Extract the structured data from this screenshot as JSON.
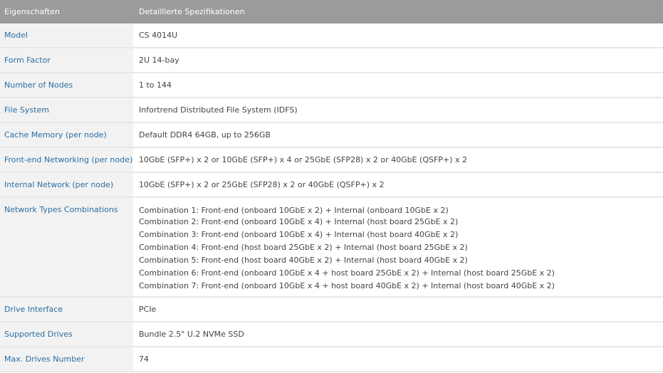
{
  "header": {
    "property": "Eigenschaften",
    "value": "Detaillierte Spezifikationen"
  },
  "rows": [
    {
      "property": "Model",
      "value": "CS 4014U"
    },
    {
      "property": "Form Factor",
      "value": "2U 14-bay"
    },
    {
      "property": "Number of Nodes",
      "value": "1 to 144"
    },
    {
      "property": "File System",
      "value": "Infortrend Distributed File System (IDFS)"
    },
    {
      "property": "Cache Memory (per node)",
      "value": "Default DDR4 64GB, up to 256GB"
    },
    {
      "property": "Front-end Networking (per node)",
      "value": "10GbE (SFP+) x 2 or 10GbE (SFP+) x 4 or 25GbE (SFP28) x 2 or 40GbE (QSFP+) x 2"
    },
    {
      "property": "Internal Network (per node)",
      "value": "10GbE (SFP+) x 2 or 25GbE (SFP28) x 2 or 40GbE (QSFP+) x 2"
    },
    {
      "property": "Network Types Combinations",
      "lines": [
        "Combination 1: Front-end (onboard 10GbE x 2) + Internal (onboard 10GbE x 2)",
        "Combination 2: Front-end (onboard 10GbE x 4) + Internal (host board 25GbE x 2)",
        "Combination 3: Front-end (onboard 10GbE x 4) + Internal (host board 40GbE x 2)",
        "Combination 4: Front-end (host board 25GbE x 2) + Internal (host board 25GbE x 2)",
        "Combination 5: Front-end (host board 40GbE x 2) + Internal (host board 40GbE x 2)",
        "Combination 6: Front-end (onboard 10GbE x 4 + host board 25GbE x 2) + Internal (host board 25GbE x 2)",
        "Combination 7: Front-end (onboard 10GbE x 4 + host board 40GbE x 2) + Internal (host board 40GbE x 2)"
      ]
    },
    {
      "property": "Drive Interface",
      "value": "PCIe"
    },
    {
      "property": "Supported Drives",
      "value": "Bundle 2.5\" U.2 NVMe SSD"
    },
    {
      "property": "Max. Drives Number",
      "value": "74"
    }
  ],
  "colors": {
    "header_bg": "#9b9b9b",
    "property_bg": "#f2f2f2",
    "property_text": "#2a6ea3",
    "value_text": "#444444"
  }
}
